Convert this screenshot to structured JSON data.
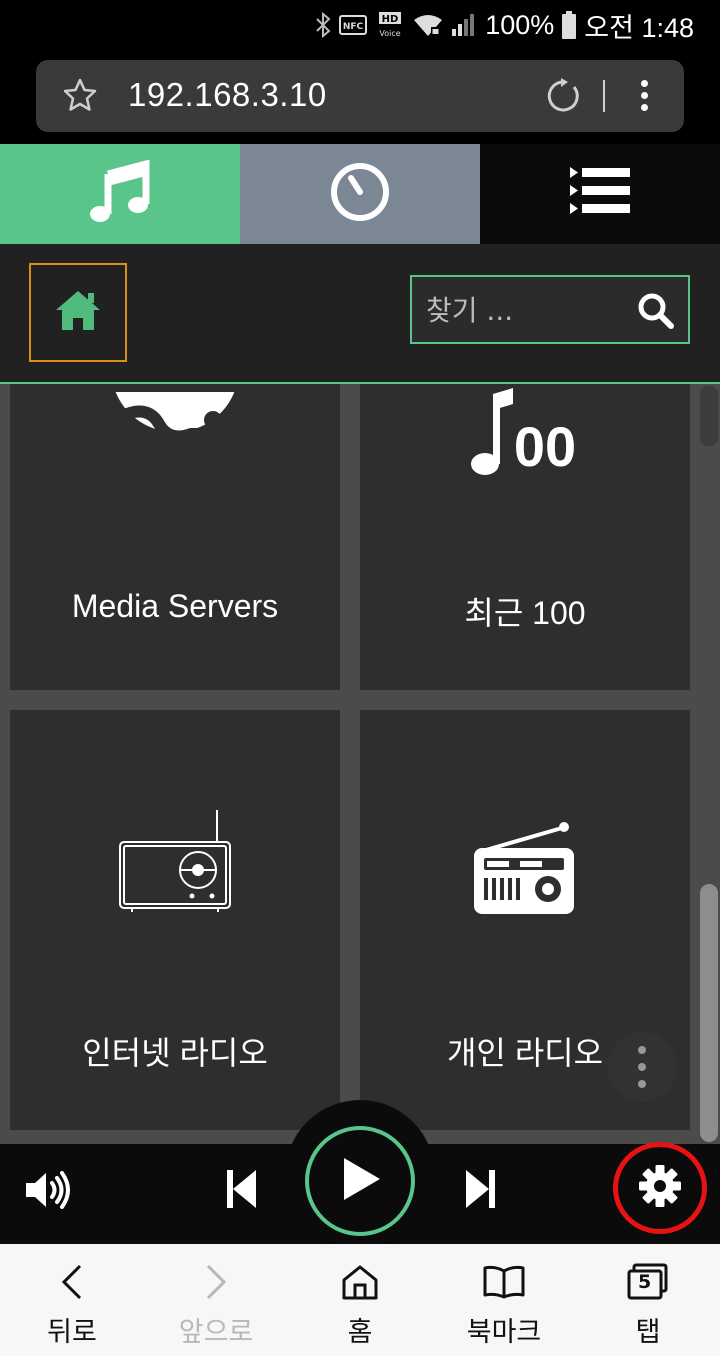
{
  "status_bar": {
    "battery_text": "100%",
    "time": "오전 1:48",
    "icons": [
      "bluetooth-icon",
      "nfc-icon",
      "hd-voice-icon",
      "wifi-icon",
      "signal-icon",
      "battery-icon"
    ]
  },
  "browser": {
    "url": "192.168.3.10"
  },
  "app_tabs": [
    {
      "name": "library",
      "icon": "music-note-icon",
      "color": "#5ac58a",
      "active": true
    },
    {
      "name": "now-playing",
      "icon": "dial-icon",
      "color": "#7b8794"
    },
    {
      "name": "queue",
      "icon": "list-icon",
      "color": "#0b0b0b"
    }
  ],
  "toolbar": {
    "home_icon": "home-icon",
    "search_placeholder": "찾기 ..."
  },
  "tiles": [
    {
      "label": "Media Servers",
      "icon": "media-servers-icon"
    },
    {
      "label": "최근 100",
      "icon": "recent-100-icon"
    },
    {
      "label": "인터넷 라디오",
      "icon": "internet-radio-icon"
    },
    {
      "label": "개인 라디오",
      "icon": "personal-radio-icon"
    }
  ],
  "player": {
    "controls": [
      "volume-icon",
      "previous-icon",
      "play-icon",
      "next-icon",
      "settings-icon"
    ]
  },
  "bottom_nav": [
    {
      "label": "뒤로",
      "icon": "back-arrow-icon",
      "enabled": true
    },
    {
      "label": "앞으로",
      "icon": "forward-arrow-icon",
      "enabled": false
    },
    {
      "label": "홈",
      "icon": "home-outline-icon",
      "enabled": true
    },
    {
      "label": "북마크",
      "icon": "book-icon",
      "enabled": true
    },
    {
      "label": "탭",
      "icon": "tabs-icon",
      "enabled": true,
      "count": "5"
    }
  ],
  "colors": {
    "accent": "#5ac58a",
    "home_border": "#d9901a",
    "highlight_ring": "#e81212"
  }
}
